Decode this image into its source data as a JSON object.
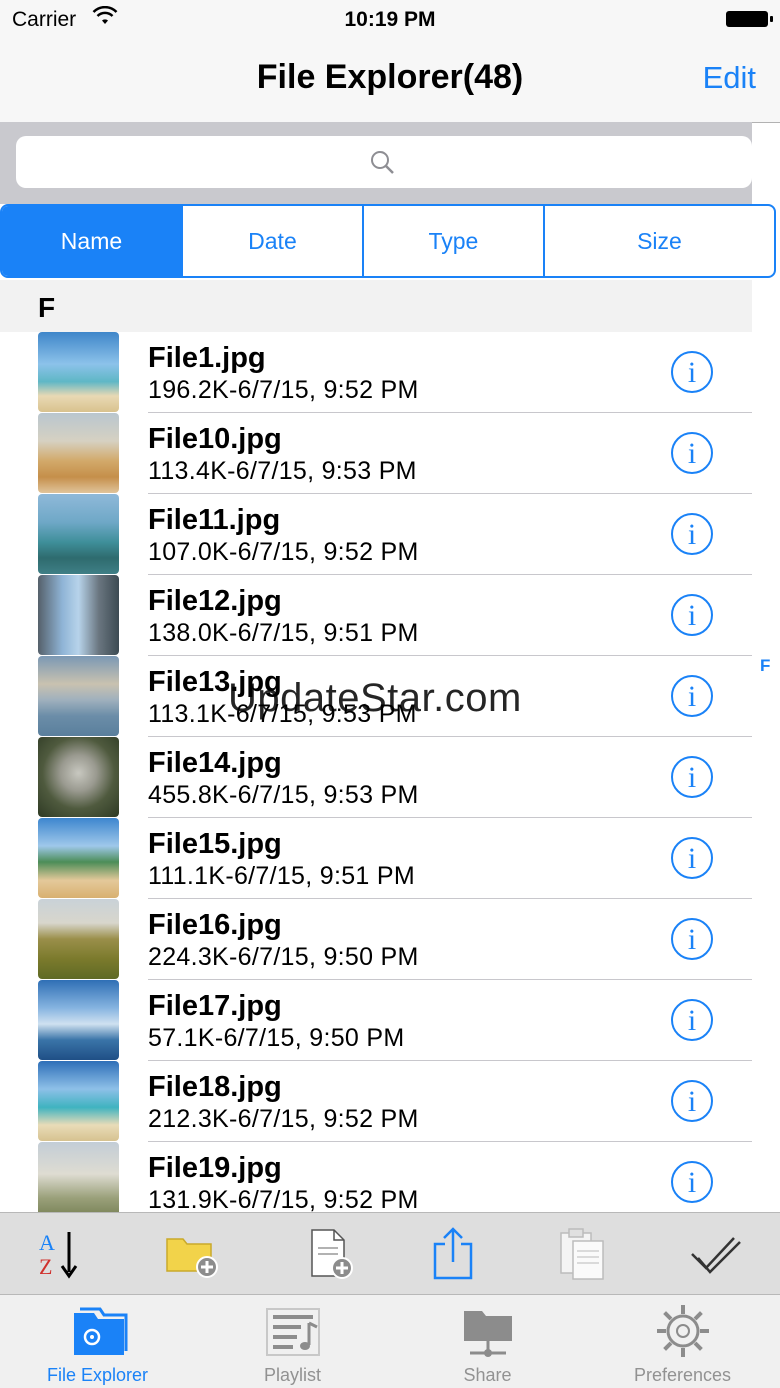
{
  "status": {
    "carrier": "Carrier",
    "time": "10:19 PM"
  },
  "nav": {
    "title": "File Explorer(48)",
    "edit_label": "Edit"
  },
  "segments": [
    "Name",
    "Date",
    "Type",
    "Size"
  ],
  "section_header": "F",
  "index_letter": "F",
  "watermark": "UpdateStar.com",
  "files": [
    {
      "name": "File1.jpg",
      "meta": "196.2K-6/7/15, 9:52 PM"
    },
    {
      "name": "File10.jpg",
      "meta": "113.4K-6/7/15, 9:53 PM"
    },
    {
      "name": "File11.jpg",
      "meta": "107.0K-6/7/15, 9:52 PM"
    },
    {
      "name": "File12.jpg",
      "meta": "138.0K-6/7/15, 9:51 PM"
    },
    {
      "name": "File13.jpg",
      "meta": "113.1K-6/7/15, 9:53 PM"
    },
    {
      "name": "File14.jpg",
      "meta": "455.8K-6/7/15, 9:53 PM"
    },
    {
      "name": "File15.jpg",
      "meta": "111.1K-6/7/15, 9:51 PM"
    },
    {
      "name": "File16.jpg",
      "meta": "224.3K-6/7/15, 9:50 PM"
    },
    {
      "name": "File17.jpg",
      "meta": "57.1K-6/7/15, 9:50 PM"
    },
    {
      "name": "File18.jpg",
      "meta": "212.3K-6/7/15, 9:52 PM"
    },
    {
      "name": "File19.jpg",
      "meta": "131.9K-6/7/15, 9:52 PM"
    }
  ],
  "tabs": [
    {
      "label": "File Explorer",
      "icon": "folder-gear-icon"
    },
    {
      "label": "Playlist",
      "icon": "playlist-icon"
    },
    {
      "label": "Share",
      "icon": "share-icon"
    },
    {
      "label": "Preferences",
      "icon": "gear-icon"
    }
  ],
  "colors": {
    "accent": "#1a82f7",
    "inactive": "#929292"
  }
}
